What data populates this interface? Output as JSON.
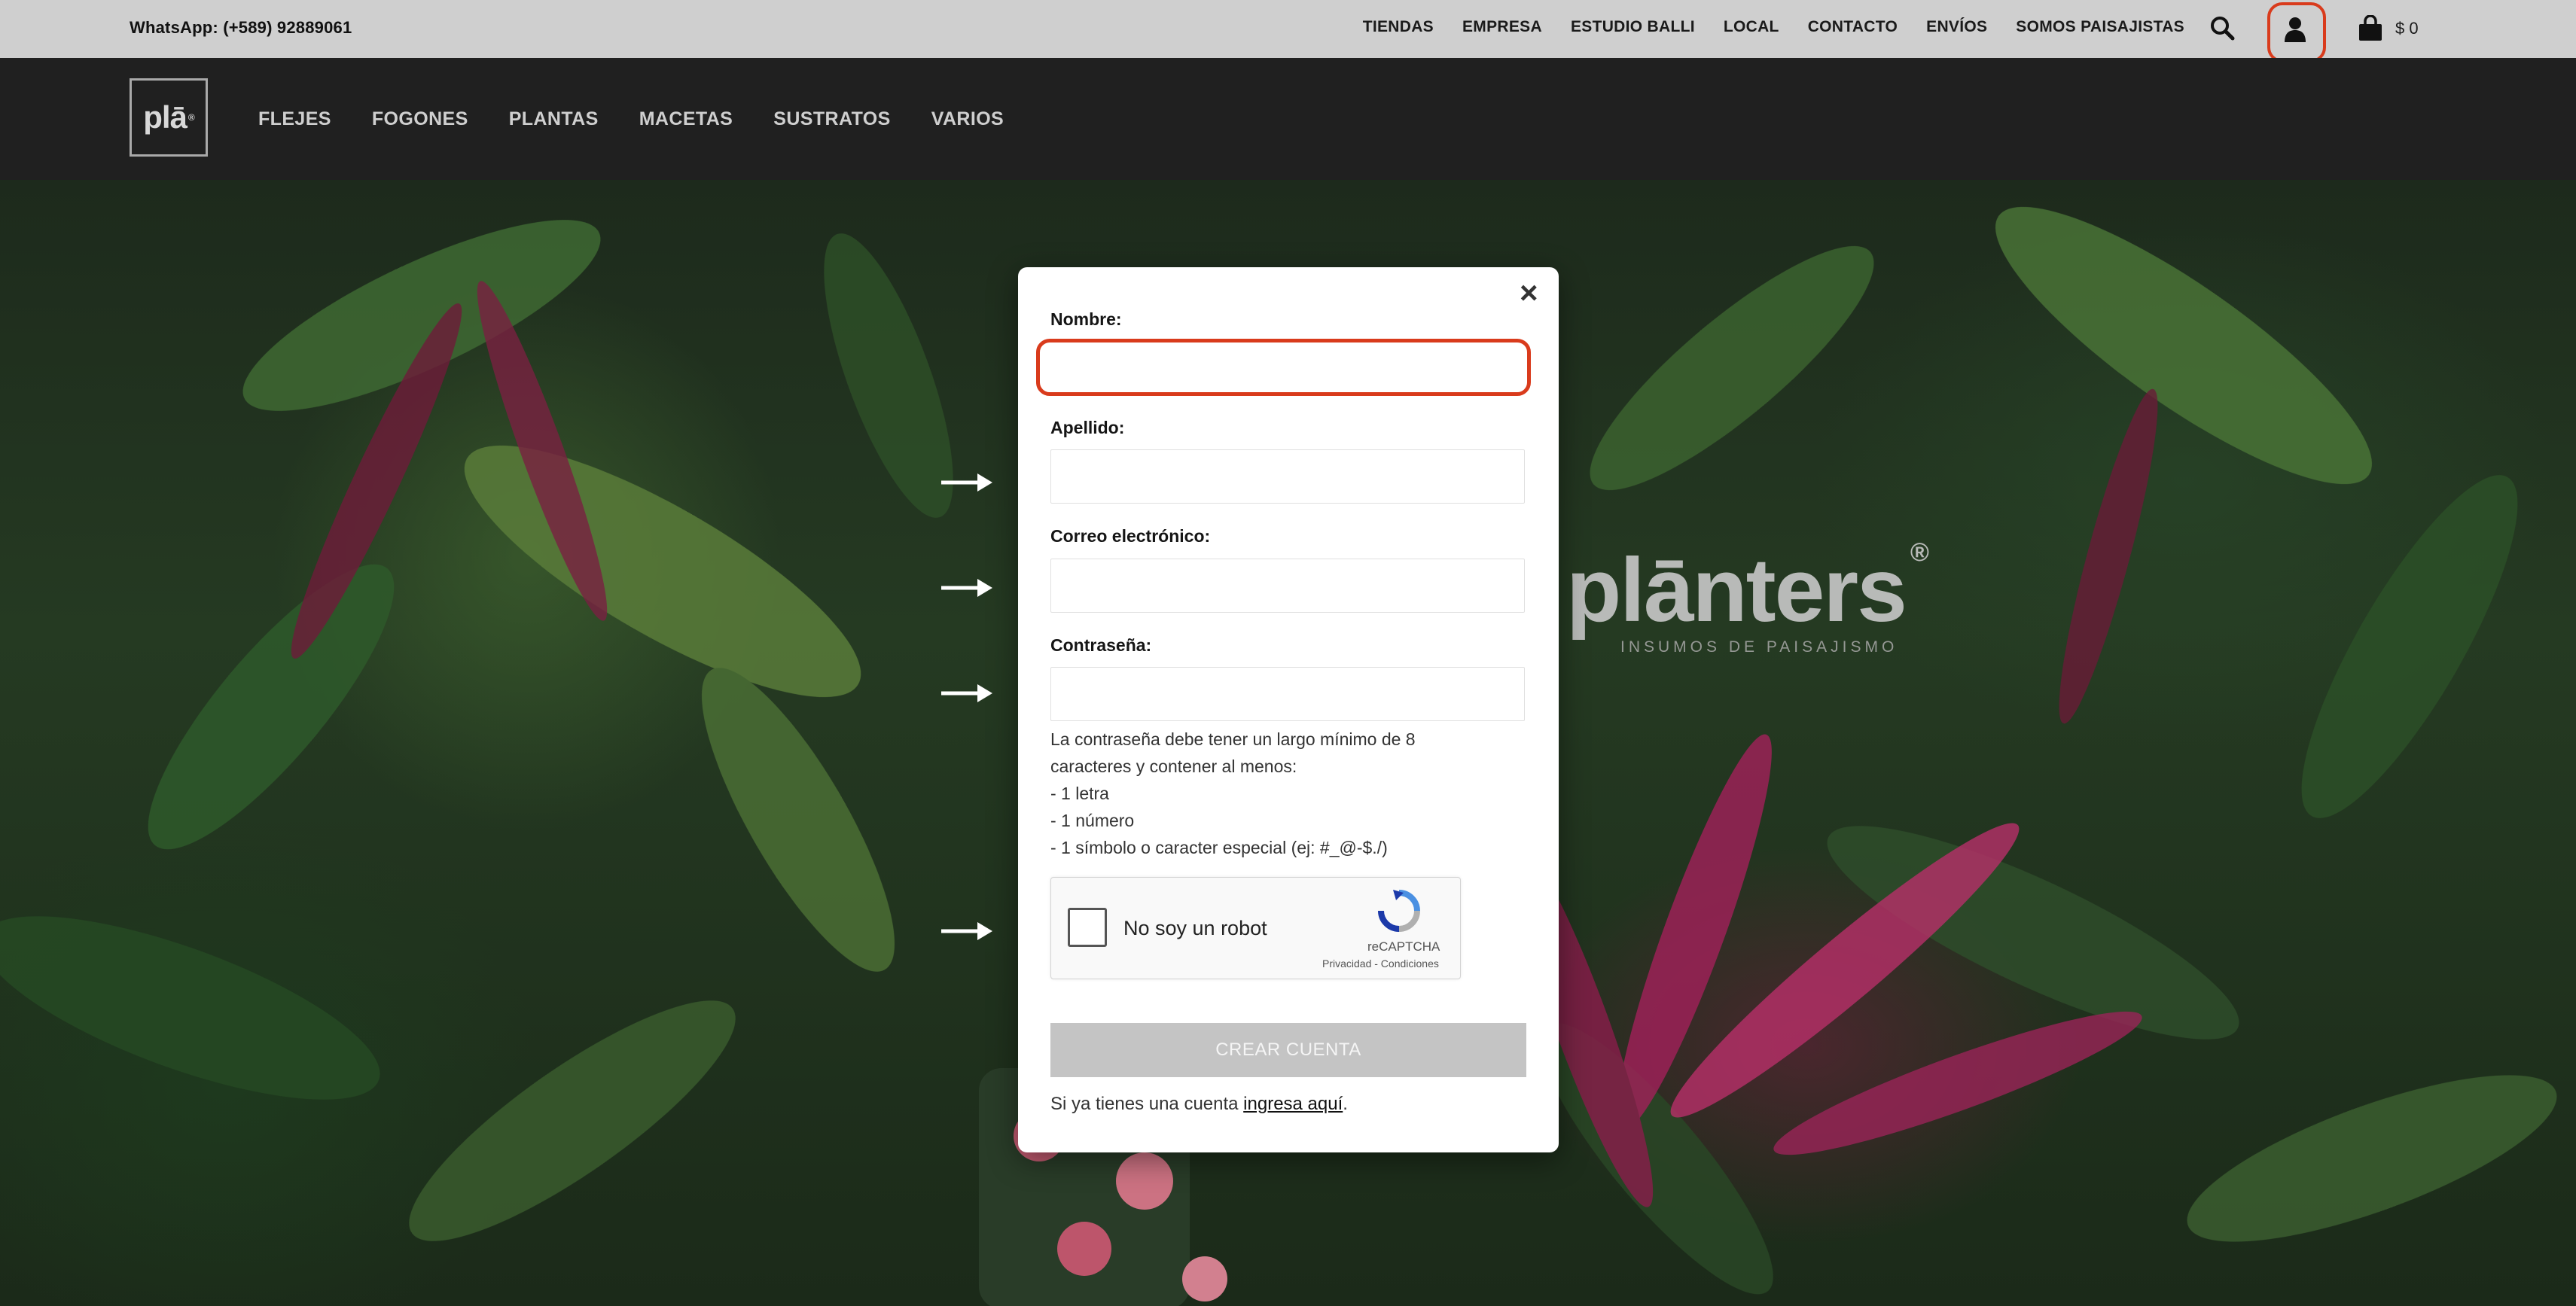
{
  "topbar": {
    "whatsapp": "WhatsApp: (+589) 92889061",
    "nav": [
      "TIENDAS",
      "EMPRESA",
      "ESTUDIO BALLI",
      "LOCAL",
      "CONTACTO",
      "ENVÍOS",
      "SOMOS PAISAJISTAS"
    ],
    "cart_total": "$ 0",
    "icons": [
      "search-icon",
      "user-icon",
      "shopping-bag-icon"
    ],
    "highlight_color": "#d93b1c"
  },
  "header": {
    "logo_text": "plā",
    "logo_mark": "®",
    "categories": [
      "FLEJES",
      "FOGONES",
      "PLANTAS",
      "MACETAS",
      "SUSTRATOS",
      "VARIOS"
    ]
  },
  "hero": {
    "brand": "plānters",
    "brand_mark": "®",
    "brand_sub": "INSUMOS DE PAISAJISMO"
  },
  "modal": {
    "close": "×",
    "fields": {
      "nombre": {
        "label": "Nombre:",
        "value": ""
      },
      "apellido": {
        "label": "Apellido:",
        "value": ""
      },
      "email": {
        "label": "Correo electrónico:",
        "value": ""
      },
      "password": {
        "label": "Contraseña:",
        "value": ""
      }
    },
    "password_help": {
      "intro1": "La contraseña debe tener un largo mínimo de 8",
      "intro2": "caracteres y contener al menos:",
      "rule1": "- 1 letra",
      "rule2": "- 1 número",
      "rule3": "- 1 símbolo o caracter especial (ej: #_@-$./)"
    },
    "recaptcha": {
      "label": "No soy un robot",
      "brand": "reCAPTCHA",
      "links": "Privacidad - Condiciones"
    },
    "submit": "CREAR CUENTA",
    "login_prefix": "Si ya tienes una cuenta ",
    "login_link": "ingresa aquí",
    "login_suffix": "."
  }
}
